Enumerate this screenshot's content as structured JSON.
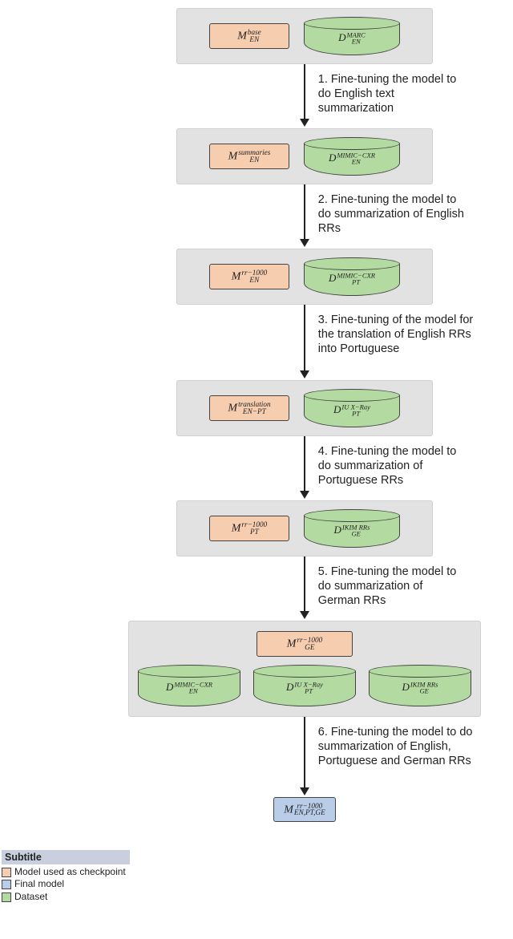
{
  "legend": {
    "title": "Subtitle",
    "items": [
      {
        "label": "Model used as checkpoint"
      },
      {
        "label": "Final model"
      },
      {
        "label": "Dataset"
      }
    ]
  },
  "steps": [
    {
      "n": "1.",
      "text": "Fine-tuning the model to do English text summarization"
    },
    {
      "n": "2.",
      "text": "Fine-tuning the model to do summarization of English RRs"
    },
    {
      "n": "3.",
      "text": "Fine-tuning of the model for the translation of English RRs into Portuguese"
    },
    {
      "n": "4.",
      "text": "Fine-tuning the model to do summarization of Portuguese RRs"
    },
    {
      "n": "5.",
      "text": "Fine-tuning the model to do summarization of German RRs"
    },
    {
      "n": "6.",
      "text": "Fine-tuning the model to do summarization of English, Portuguese and German RRs"
    }
  ],
  "stages": [
    {
      "model": {
        "base": "M",
        "sub": "EN",
        "sup": "base"
      },
      "datasets": [
        {
          "base": "D",
          "sub": "EN",
          "sup": "MARC"
        }
      ]
    },
    {
      "model": {
        "base": "M",
        "sub": "EN",
        "sup": "summaries"
      },
      "datasets": [
        {
          "base": "D",
          "sub": "EN",
          "sup": "MIMIC−CXR"
        }
      ]
    },
    {
      "model": {
        "base": "M",
        "sub": "EN",
        "sup": "rr−1000"
      },
      "datasets": [
        {
          "base": "D",
          "sub": "PT",
          "sup": "MIMIC−CXR"
        }
      ]
    },
    {
      "model": {
        "base": "M",
        "sub": "EN−PT",
        "sup": "translation"
      },
      "datasets": [
        {
          "base": "D",
          "sub": "PT",
          "sup": "IU X−Ray"
        }
      ]
    },
    {
      "model": {
        "base": "M",
        "sub": "PT",
        "sup": "rr−1000"
      },
      "datasets": [
        {
          "base": "D",
          "sub": "GE",
          "sup": "IKIM RRs"
        }
      ]
    },
    {
      "model": {
        "base": "M",
        "sub": "GE",
        "sup": "rr−1000"
      },
      "datasets": [
        {
          "base": "D",
          "sub": "EN",
          "sup": "MIMIC−CXR"
        },
        {
          "base": "D",
          "sub": "PT",
          "sup": "IU X−Ray"
        },
        {
          "base": "D",
          "sub": "GE",
          "sup": "IKIM RRs"
        }
      ]
    }
  ],
  "final": {
    "base": "M",
    "sub": "EN,PT,GE",
    "sup": "rr−1000"
  },
  "arrow_heights": [
    70,
    70,
    80,
    70,
    70,
    86
  ]
}
